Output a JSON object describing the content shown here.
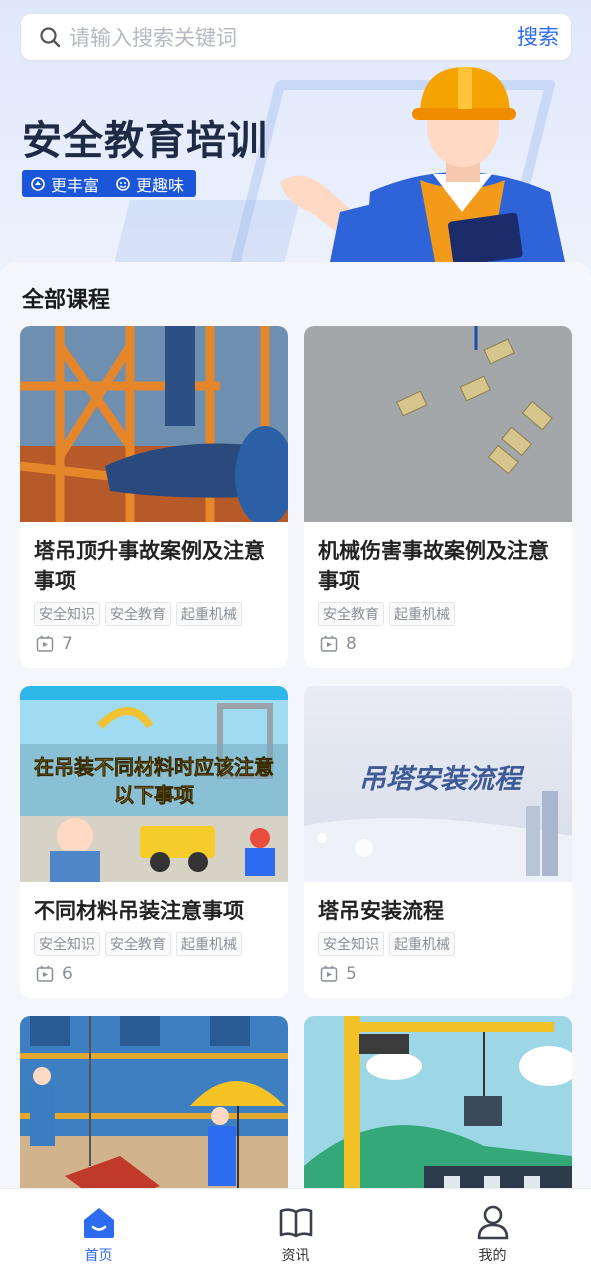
{
  "search": {
    "placeholder": "请输入搜索关键词",
    "button": "搜索"
  },
  "banner": {
    "title": "安全教育培训",
    "tags": [
      "更丰富",
      "更趣味"
    ]
  },
  "section": {
    "title": "全部课程"
  },
  "courses": [
    {
      "title": "塔吊顶升事故案例及注意事项",
      "tags": [
        "安全知识",
        "安全教育",
        "起重机械"
      ],
      "count": "7"
    },
    {
      "title": "机械伤害事故案例及注意事项",
      "tags": [
        "安全教育",
        "起重机械"
      ],
      "count": "8"
    },
    {
      "title": "不同材料吊装注意事项",
      "tags": [
        "安全知识",
        "安全教育",
        "起重机械"
      ],
      "count": "6",
      "thumb_text": [
        "在吊装不同材料时应该注意",
        "以下事项"
      ]
    },
    {
      "title": "塔吊安装流程",
      "tags": [
        "安全知识",
        "起重机械"
      ],
      "count": "5",
      "thumb_text": "吊塔安装流程"
    }
  ],
  "nav": {
    "items": [
      {
        "label": "首页",
        "icon": "home-icon",
        "active": true
      },
      {
        "label": "资讯",
        "icon": "book-icon",
        "active": false
      },
      {
        "label": "我的",
        "icon": "user-icon",
        "active": false
      }
    ]
  },
  "colors": {
    "accent": "#2d6cf0",
    "banner_tag_bg": "#1b55d9",
    "hard_hat": "#f5a300"
  }
}
